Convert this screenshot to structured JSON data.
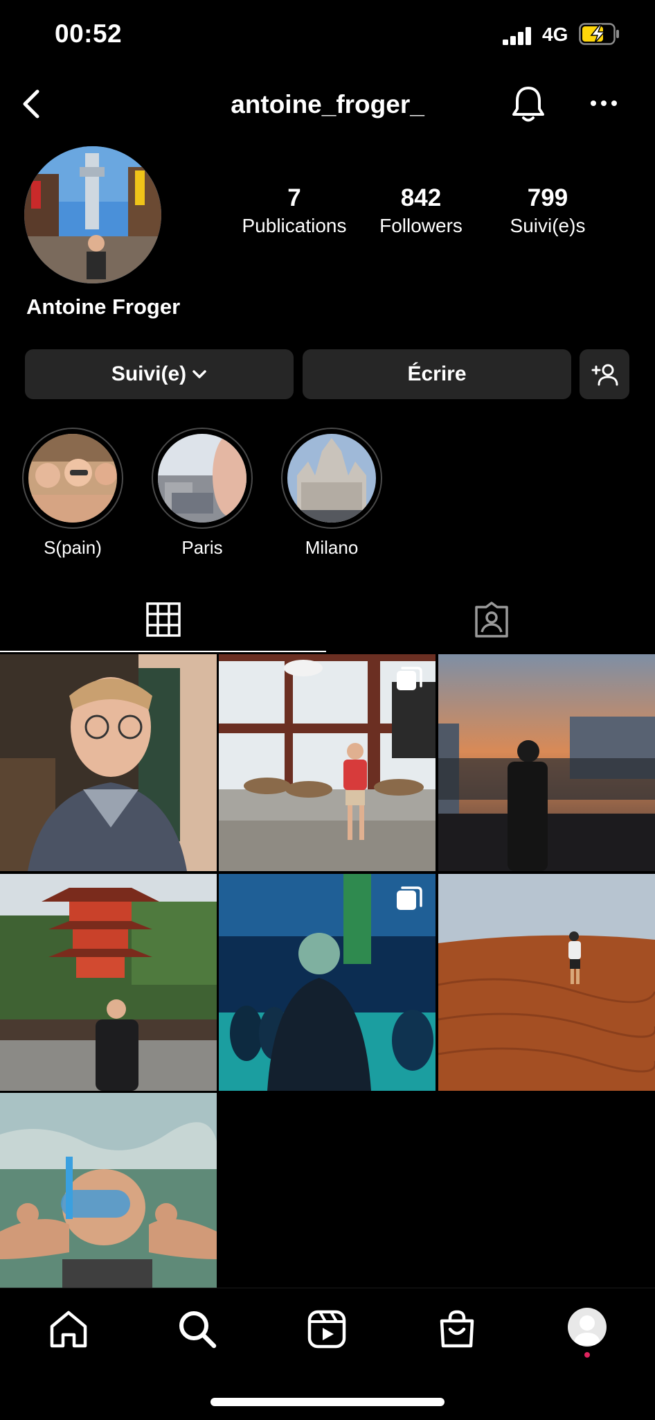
{
  "status_bar": {
    "time": "00:52",
    "network": "4G"
  },
  "header": {
    "username": "antoine_froger_"
  },
  "profile": {
    "full_name": "Antoine Froger",
    "stats": [
      {
        "value": "7",
        "label": "Publications"
      },
      {
        "value": "842",
        "label": "Followers"
      },
      {
        "value": "799",
        "label": "Suivi(e)s"
      }
    ]
  },
  "actions": {
    "follow_label": "Suivi(e)",
    "message_label": "Écrire"
  },
  "highlights": [
    {
      "label": "S(pain)"
    },
    {
      "label": "Paris"
    },
    {
      "label": "Milano"
    }
  ],
  "tabs": [
    "grid-icon",
    "tagged-icon"
  ],
  "posts": [
    {
      "subject": "selfie-with-glasses",
      "multi": false
    },
    {
      "subject": "sitting-with-deer",
      "multi": true
    },
    {
      "subject": "sunset-silhouette",
      "multi": false
    },
    {
      "subject": "pagoda",
      "multi": false
    },
    {
      "subject": "concert-blue-light",
      "multi": true
    },
    {
      "subject": "desert-dunes",
      "multi": false
    },
    {
      "subject": "snorkeling-underwater",
      "multi": false
    }
  ],
  "bottom_nav": [
    "home-icon",
    "search-icon",
    "reels-icon",
    "shop-icon",
    "profile-avatar"
  ],
  "colors": {
    "background": "#000000",
    "button": "#262626",
    "notification_dot": "#e0245e"
  }
}
